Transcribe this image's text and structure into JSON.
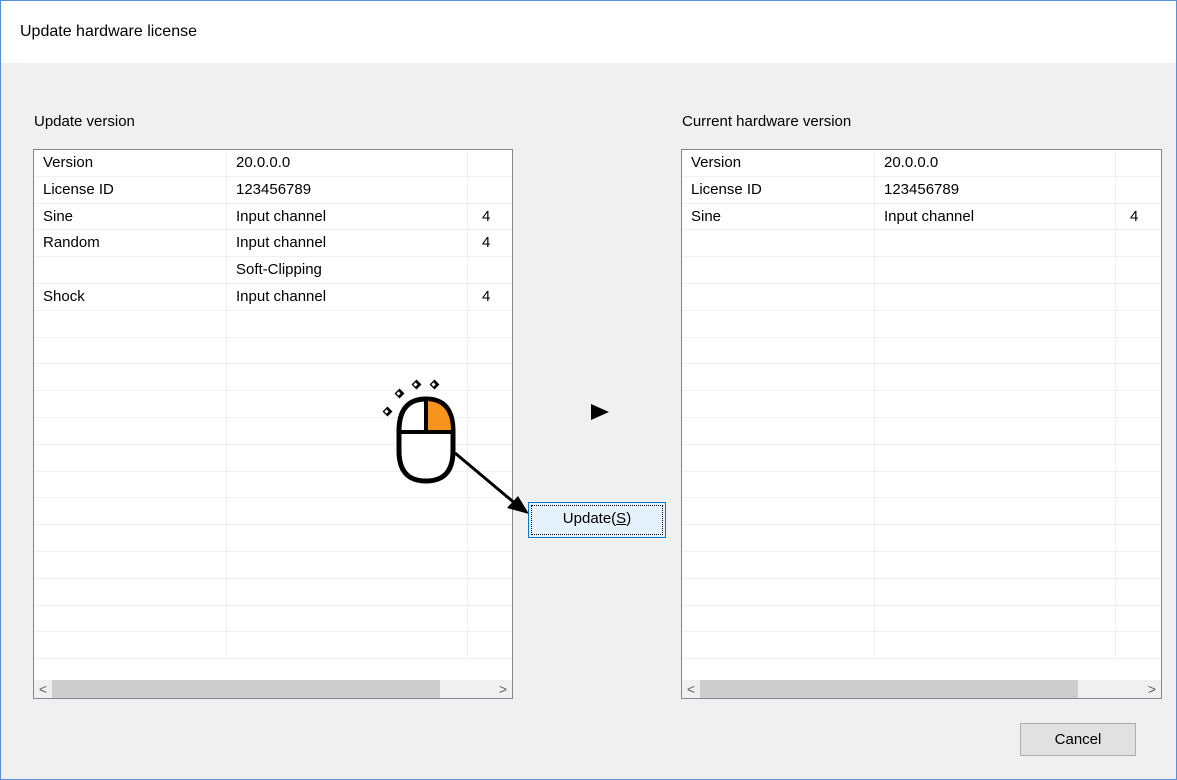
{
  "window": {
    "title": "Update hardware license"
  },
  "update_panel": {
    "label": "Update version",
    "rows": [
      [
        "Version",
        "20.0.0.0",
        ""
      ],
      [
        "License ID",
        "123456789",
        ""
      ],
      [
        "Sine",
        "Input channel",
        "4"
      ],
      [
        "Random",
        "Input channel",
        "4"
      ],
      [
        "",
        "Soft-Clipping",
        ""
      ],
      [
        "Shock",
        "Input channel",
        "4"
      ],
      [
        "",
        "",
        ""
      ],
      [
        "",
        "",
        ""
      ],
      [
        "",
        "",
        ""
      ],
      [
        "",
        "",
        ""
      ],
      [
        "",
        "",
        ""
      ],
      [
        "",
        "",
        ""
      ],
      [
        "",
        "",
        ""
      ],
      [
        "",
        "",
        ""
      ],
      [
        "",
        "",
        ""
      ],
      [
        "",
        "",
        ""
      ],
      [
        "",
        "",
        ""
      ],
      [
        "",
        "",
        ""
      ],
      [
        "",
        "",
        ""
      ]
    ]
  },
  "current_panel": {
    "label": "Current hardware version",
    "rows": [
      [
        "Version",
        "20.0.0.0",
        ""
      ],
      [
        "License ID",
        "123456789",
        ""
      ],
      [
        "Sine",
        "Input channel",
        "4"
      ],
      [
        "",
        "",
        ""
      ],
      [
        "",
        "",
        ""
      ],
      [
        "",
        "",
        ""
      ],
      [
        "",
        "",
        ""
      ],
      [
        "",
        "",
        ""
      ],
      [
        "",
        "",
        ""
      ],
      [
        "",
        "",
        ""
      ],
      [
        "",
        "",
        ""
      ],
      [
        "",
        "",
        ""
      ],
      [
        "",
        "",
        ""
      ],
      [
        "",
        "",
        ""
      ],
      [
        "",
        "",
        ""
      ],
      [
        "",
        "",
        ""
      ],
      [
        "",
        "",
        ""
      ],
      [
        "",
        "",
        ""
      ],
      [
        "",
        "",
        ""
      ]
    ]
  },
  "buttons": {
    "update_prefix": "Update(",
    "update_mnemonic": "S",
    "update_suffix": ")",
    "cancel": "Cancel"
  },
  "scrollbar": {
    "left_arrow": "<",
    "right_arrow": ">"
  },
  "icons": {
    "transfer": "right-arrow-icon",
    "annotation": "mouse-right-click-icon",
    "annotation_accent": "#f7941d"
  }
}
